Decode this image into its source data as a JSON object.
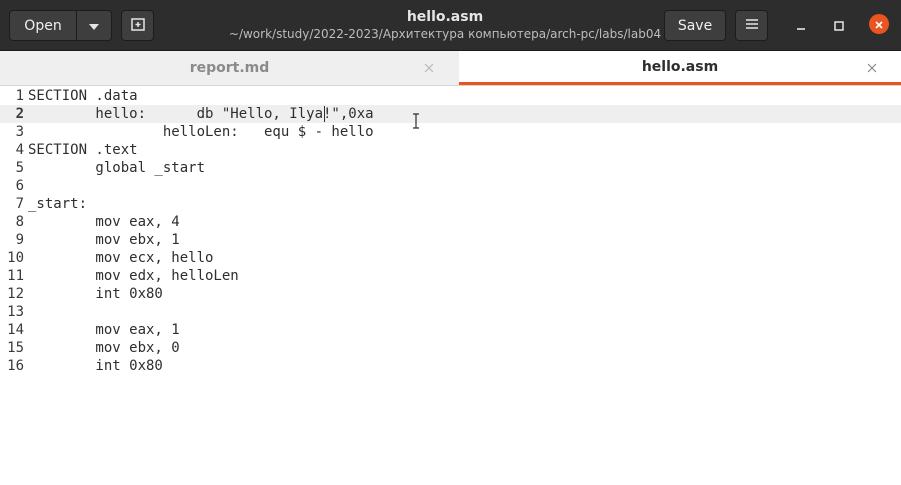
{
  "header": {
    "open_label": "Open",
    "save_label": "Save",
    "title": "hello.asm",
    "subtitle": "~/work/study/2022-2023/Архитектура компьютера/arch-pc/labs/lab04"
  },
  "tabs": [
    {
      "label": "report.md",
      "active": false
    },
    {
      "label": "hello.asm",
      "active": true
    }
  ],
  "editor": {
    "current_line": 2,
    "lines": [
      {
        "num": "1",
        "text": "SECTION .data"
      },
      {
        "num": "2",
        "text": "        hello:      db \"Hello, Ilya!\",0xa"
      },
      {
        "num": "3",
        "text": "                helloLen:   equ $ - hello"
      },
      {
        "num": "4",
        "text": "SECTION .text"
      },
      {
        "num": "5",
        "text": "        global _start"
      },
      {
        "num": "6",
        "text": ""
      },
      {
        "num": "7",
        "text": "_start:"
      },
      {
        "num": "8",
        "text": "        mov eax, 4"
      },
      {
        "num": "9",
        "text": "        mov ebx, 1"
      },
      {
        "num": "10",
        "text": "        mov ecx, hello"
      },
      {
        "num": "11",
        "text": "        mov edx, helloLen"
      },
      {
        "num": "12",
        "text": "        int 0x80"
      },
      {
        "num": "13",
        "text": ""
      },
      {
        "num": "14",
        "text": "        mov eax, 1"
      },
      {
        "num": "15",
        "text": "        mov ebx, 0"
      },
      {
        "num": "16",
        "text": "        int 0x80"
      }
    ]
  },
  "icons": {
    "open_menu": "chevron-down-icon",
    "new_tab": "new-tab-icon",
    "menu": "hamburger-menu-icon",
    "minimize": "minimize-icon",
    "maximize": "maximize-icon",
    "close": "close-icon"
  },
  "colors": {
    "header_bg": "#2d2d2d",
    "accent": "#e95420",
    "current_line_bg": "#efefef"
  }
}
